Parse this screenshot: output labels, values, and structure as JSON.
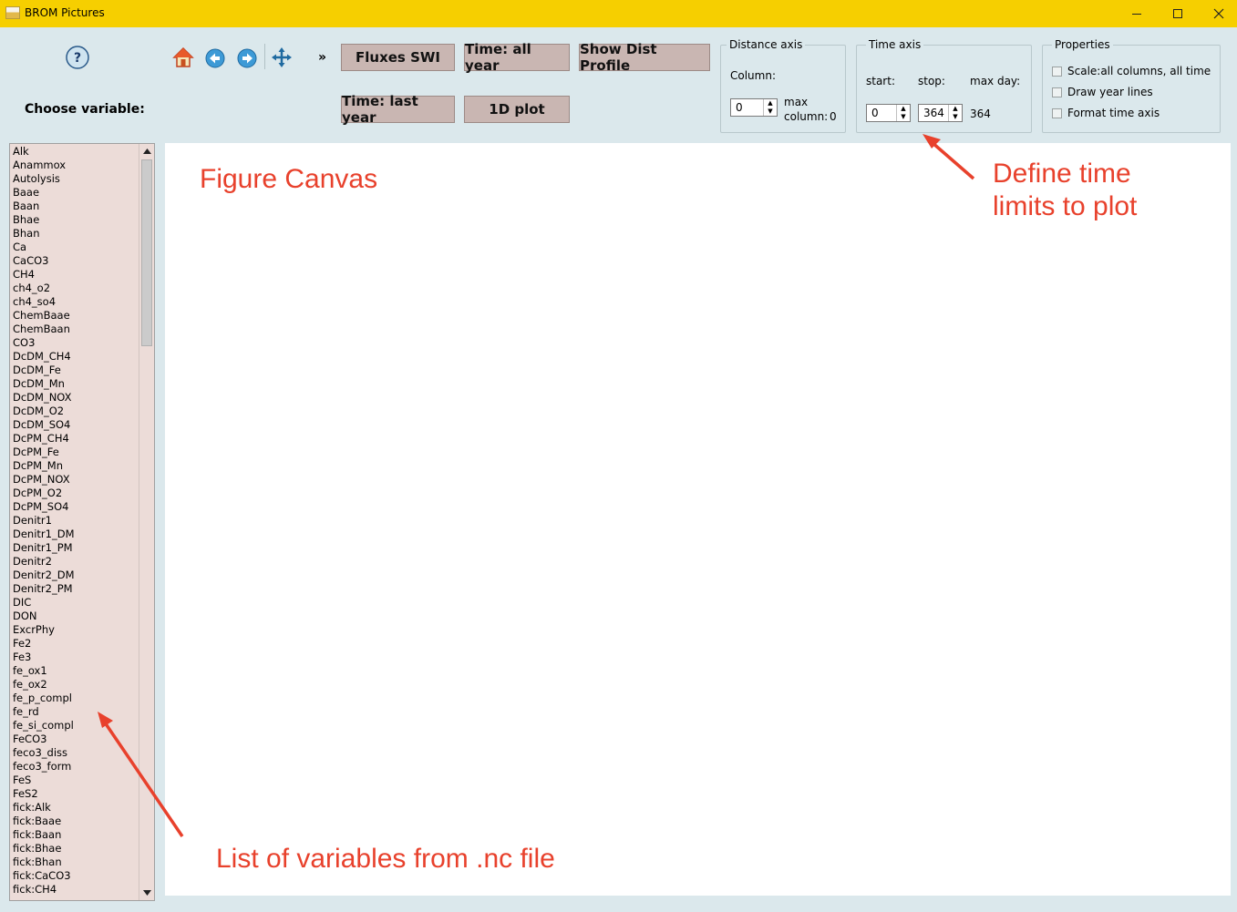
{
  "window": {
    "title": "BROM Pictures",
    "minimize": "–",
    "maximize": "☐",
    "close": "✕"
  },
  "toolbar": {
    "help_icon": "?",
    "icons": [
      "home-icon",
      "back-icon",
      "forward-icon",
      "pan-icon"
    ],
    "overflow": "»",
    "buttons_row1": [
      "Fluxes SWI",
      "Time: all year",
      "Show Dist Profile"
    ],
    "buttons_row2": [
      "Time: last year",
      "1D plot"
    ]
  },
  "choose_variable_label": "Choose variable:",
  "distance_axis": {
    "title": "Distance axis",
    "column_label": "Column:",
    "column_value": "0",
    "max_label_1": "max",
    "max_label_2": "column:",
    "max_value": "0"
  },
  "time_axis": {
    "title": "Time axis",
    "start_label": "start:",
    "stop_label": "stop:",
    "max_day_label": "max day:",
    "start_value": "0",
    "stop_value": "364",
    "max_day_value": "364"
  },
  "properties": {
    "title": "Properties",
    "options": [
      "Scale:all columns, all time",
      "Draw year lines",
      "Format time axis"
    ]
  },
  "variables": [
    "Alk",
    "Anammox",
    "Autolysis",
    "Baae",
    "Baan",
    "Bhae",
    "Bhan",
    "Ca",
    "CaCO3",
    "CH4",
    "ch4_o2",
    "ch4_so4",
    "ChemBaae",
    "ChemBaan",
    "CO3",
    "DcDM_CH4",
    "DcDM_Fe",
    "DcDM_Mn",
    "DcDM_NOX",
    "DcDM_O2",
    "DcDM_SO4",
    "DcPM_CH4",
    "DcPM_Fe",
    "DcPM_Mn",
    "DcPM_NOX",
    "DcPM_O2",
    "DcPM_SO4",
    "Denitr1",
    "Denitr1_DM",
    "Denitr1_PM",
    "Denitr2",
    "Denitr2_DM",
    "Denitr2_PM",
    "DIC",
    "DON",
    "ExcrPhy",
    "Fe2",
    "Fe3",
    "fe_ox1",
    "fe_ox2",
    "fe_p_compl",
    "fe_rd",
    "fe_si_compl",
    "FeCO3",
    "feco3_diss",
    "feco3_form",
    "FeS",
    "FeS2",
    "fick:Alk",
    "fick:Baae",
    "fick:Baan",
    "fick:Bhae",
    "fick:Bhan",
    "fick:CaCO3",
    "fick:CH4"
  ],
  "annotations": {
    "canvas": "Figure Canvas",
    "time_limits_1": "Define time",
    "time_limits_2": "limits to plot",
    "list": "List of variables from .nc file"
  },
  "colors": {
    "titlebar": "#f6cf00",
    "background": "#dbe8ec",
    "button": "#c9b6b2",
    "list_bg": "#ecdcd8",
    "annotation": "#e8412c"
  }
}
